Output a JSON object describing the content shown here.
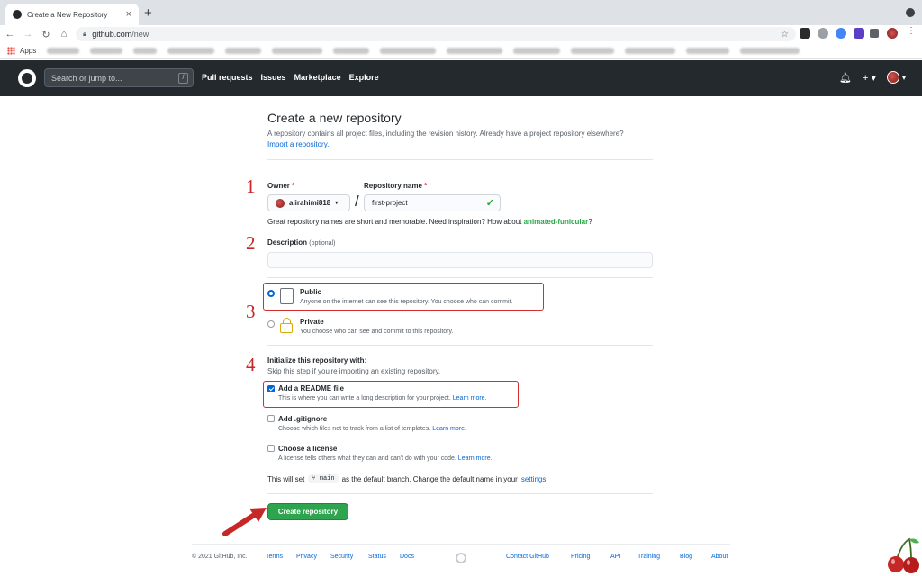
{
  "browser": {
    "tab_title": "Create a New Repository",
    "url_host": "github.com",
    "url_path": "/new",
    "bookmarks_apps": "Apps"
  },
  "header": {
    "search_placeholder": "Search or jump to...",
    "search_key": "/",
    "nav": [
      "Pull requests",
      "Issues",
      "Marketplace",
      "Explore"
    ]
  },
  "page": {
    "title": "Create a new repository",
    "subtitle": "A repository contains all project files, including the revision history. Already have a project repository elsewhere?",
    "import_link": "Import a repository.",
    "owner_label": "Owner",
    "repo_name_label": "Repository name",
    "required_mark": "*",
    "owner_value": "alirahimi818",
    "repo_name_value": "first-project",
    "name_hint": "Great repository names are short and memorable. Need inspiration? How about",
    "name_suggestion": "animated-funicular",
    "name_hint_end": "?",
    "description_label": "Description",
    "description_optional": "(optional)",
    "description_value": "",
    "visibility": {
      "public_title": "Public",
      "public_desc": "Anyone on the internet can see this repository. You choose who can commit.",
      "private_title": "Private",
      "private_desc": "You choose who can see and commit to this repository.",
      "selected": "public"
    },
    "init_title": "Initialize this repository with:",
    "init_desc": "Skip this step if you're importing an existing repository.",
    "options": {
      "readme_title": "Add a README file",
      "readme_desc": "This is where you can write a long description for your project.",
      "readme_checked": true,
      "gitignore_title": "Add .gitignore",
      "gitignore_desc": "Choose which files not to track from a list of templates.",
      "license_title": "Choose a license",
      "license_desc": "A license tells others what they can and can't do with your code.",
      "learn_more": "Learn more."
    },
    "branch_prefix": "This will set",
    "branch_name": "main",
    "branch_suffix": "as the default branch. Change the default name in your",
    "branch_settings": "settings",
    "branch_end": ".",
    "create_button": "Create repository"
  },
  "annotations": {
    "markers": [
      "1",
      "2",
      "3",
      "4"
    ],
    "highlight_color": "#d32f2f"
  },
  "footer": {
    "copyright": "© 2021 GitHub, Inc.",
    "links": [
      "Terms",
      "Privacy",
      "Security",
      "Status",
      "Docs",
      "Contact GitHub",
      "Pricing",
      "API",
      "Training",
      "Blog",
      "About"
    ]
  },
  "colors": {
    "header_bg": "#24292e",
    "primary_button": "#2ea44f",
    "link": "#0366d6",
    "suggestion": "#28a745"
  }
}
